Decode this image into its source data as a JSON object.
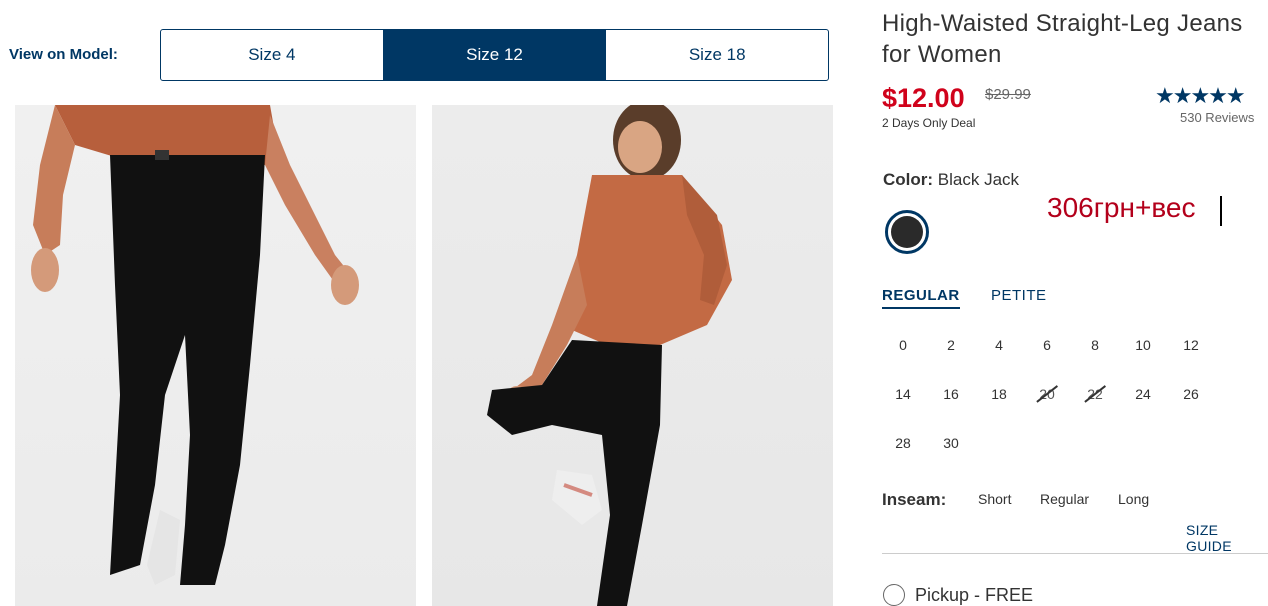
{
  "view_on_model": {
    "label": "View on Model:",
    "tabs": [
      {
        "label": "Size 4",
        "active": false
      },
      {
        "label": "Size 12",
        "active": true
      },
      {
        "label": "Size 18",
        "active": false
      }
    ]
  },
  "product": {
    "title": "High-Waisted Straight-Leg Jeans for Women",
    "price": "$12.00",
    "original_price": "$29.99",
    "deal": "2 Days Only Deal",
    "rating_stars": "★★★★★",
    "reviews": "530 Reviews"
  },
  "color": {
    "label": "Color:",
    "value": "Black Jack",
    "swatch_color": "#2a2a2a"
  },
  "annotation_text": "306грн+вес",
  "fit_tabs": {
    "regular": "REGULAR",
    "petite": "PETITE"
  },
  "sizes": [
    {
      "label": "0",
      "available": true
    },
    {
      "label": "2",
      "available": true
    },
    {
      "label": "4",
      "available": true
    },
    {
      "label": "6",
      "available": true
    },
    {
      "label": "8",
      "available": true
    },
    {
      "label": "10",
      "available": true
    },
    {
      "label": "12",
      "available": true
    },
    {
      "label": "14",
      "available": true
    },
    {
      "label": "16",
      "available": true
    },
    {
      "label": "18",
      "available": true
    },
    {
      "label": "20",
      "available": false
    },
    {
      "label": "22",
      "available": false
    },
    {
      "label": "24",
      "available": true
    },
    {
      "label": "26",
      "available": true
    },
    {
      "label": "28",
      "available": true
    },
    {
      "label": "30",
      "available": true
    }
  ],
  "inseam": {
    "label": "Inseam:",
    "options": [
      "Short",
      "Regular",
      "Long"
    ]
  },
  "size_guide": "SIZE GUIDE",
  "pickup": "Pickup - FREE",
  "colors": {
    "brand_navy": "#003764",
    "sale_red": "#d0021b"
  }
}
